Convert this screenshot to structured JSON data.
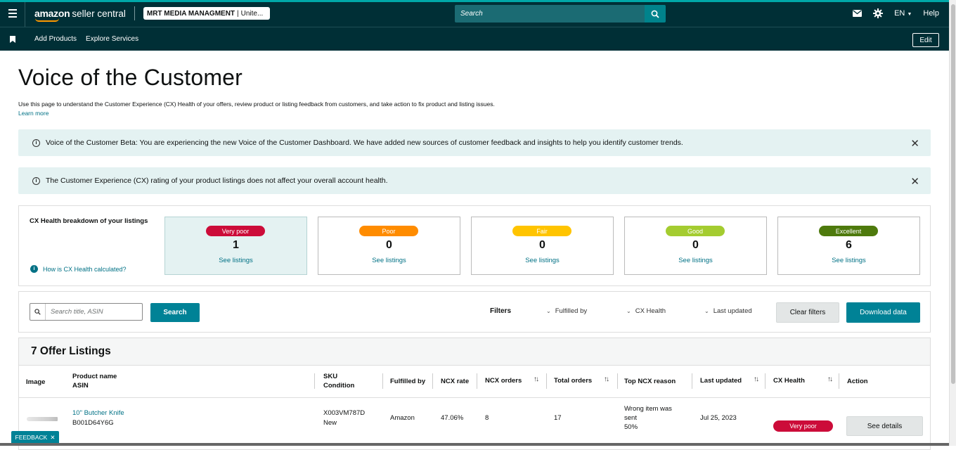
{
  "header": {
    "brand_bold": "amazon",
    "brand_rest": "seller central",
    "account_name": "MRT MEDIA MANAGMENT",
    "account_region": "Unite...",
    "search_placeholder": "Search",
    "language": "EN",
    "help": "Help"
  },
  "nav": {
    "items": [
      "Add Products",
      "Explore Services"
    ],
    "edit": "Edit"
  },
  "page": {
    "title": "Voice of the Customer",
    "description": "Use this page to understand the Customer Experience (CX) Health of your offers, review product or listing feedback from customers, and take action to fix product and listing issues.",
    "learn_more": "Learn more"
  },
  "alerts": [
    {
      "text": "Voice of the Customer Beta: You are experiencing the new Voice of the Customer Dashboard. We have added new sources of customer feedback and insights to help you identify customer trends."
    },
    {
      "text": "The Customer Experience (CX) rating of your product listings does not affect your overall account health."
    }
  ],
  "cx_health": {
    "title": "CX Health breakdown of your listings",
    "help_link": "How is CX Health calculated?",
    "see_listings": "See listings",
    "cards": [
      {
        "label": "Very poor",
        "count": "1",
        "color": "#cc0c39"
      },
      {
        "label": "Poor",
        "count": "0",
        "color": "#ff8c00"
      },
      {
        "label": "Fair",
        "count": "0",
        "color": "#ffc400"
      },
      {
        "label": "Good",
        "count": "0",
        "color": "#a4cc30"
      },
      {
        "label": "Excellent",
        "count": "6",
        "color": "#4e7a0d"
      }
    ]
  },
  "filters": {
    "search_placeholder": "Search title, ASIN",
    "search_button": "Search",
    "label": "Filters",
    "dropdowns": [
      "Fulfilled by",
      "CX Health",
      "Last updated"
    ],
    "clear": "Clear filters",
    "download": "Download data"
  },
  "listings": {
    "title": "7 Offer Listings",
    "columns": {
      "image": "Image",
      "product_name": "Product name",
      "asin": "ASIN",
      "sku": "SKU",
      "condition": "Condition",
      "fulfilled_by": "Fulfilled by",
      "ncx_rate": "NCX rate",
      "ncx_orders": "NCX orders",
      "total_orders": "Total orders",
      "top_ncx_reason": "Top NCX reason",
      "last_updated": "Last updated",
      "cx_health": "CX Health",
      "action": "Action"
    },
    "rows": [
      {
        "product_name": "10\" Butcher Knife",
        "asin": "B001D64Y6G",
        "sku": "X003VM787D",
        "condition": "New",
        "fulfilled_by": "Amazon",
        "ncx_rate": "47.06%",
        "ncx_orders": "8",
        "total_orders": "17",
        "reason_line1": "Wrong item was",
        "reason_line2": "sent",
        "reason_pct": "50%",
        "last_updated": "Jul 25, 2023",
        "cx_health": "Very poor",
        "action": "See details"
      }
    ]
  },
  "feedback": "FEEDBACK"
}
